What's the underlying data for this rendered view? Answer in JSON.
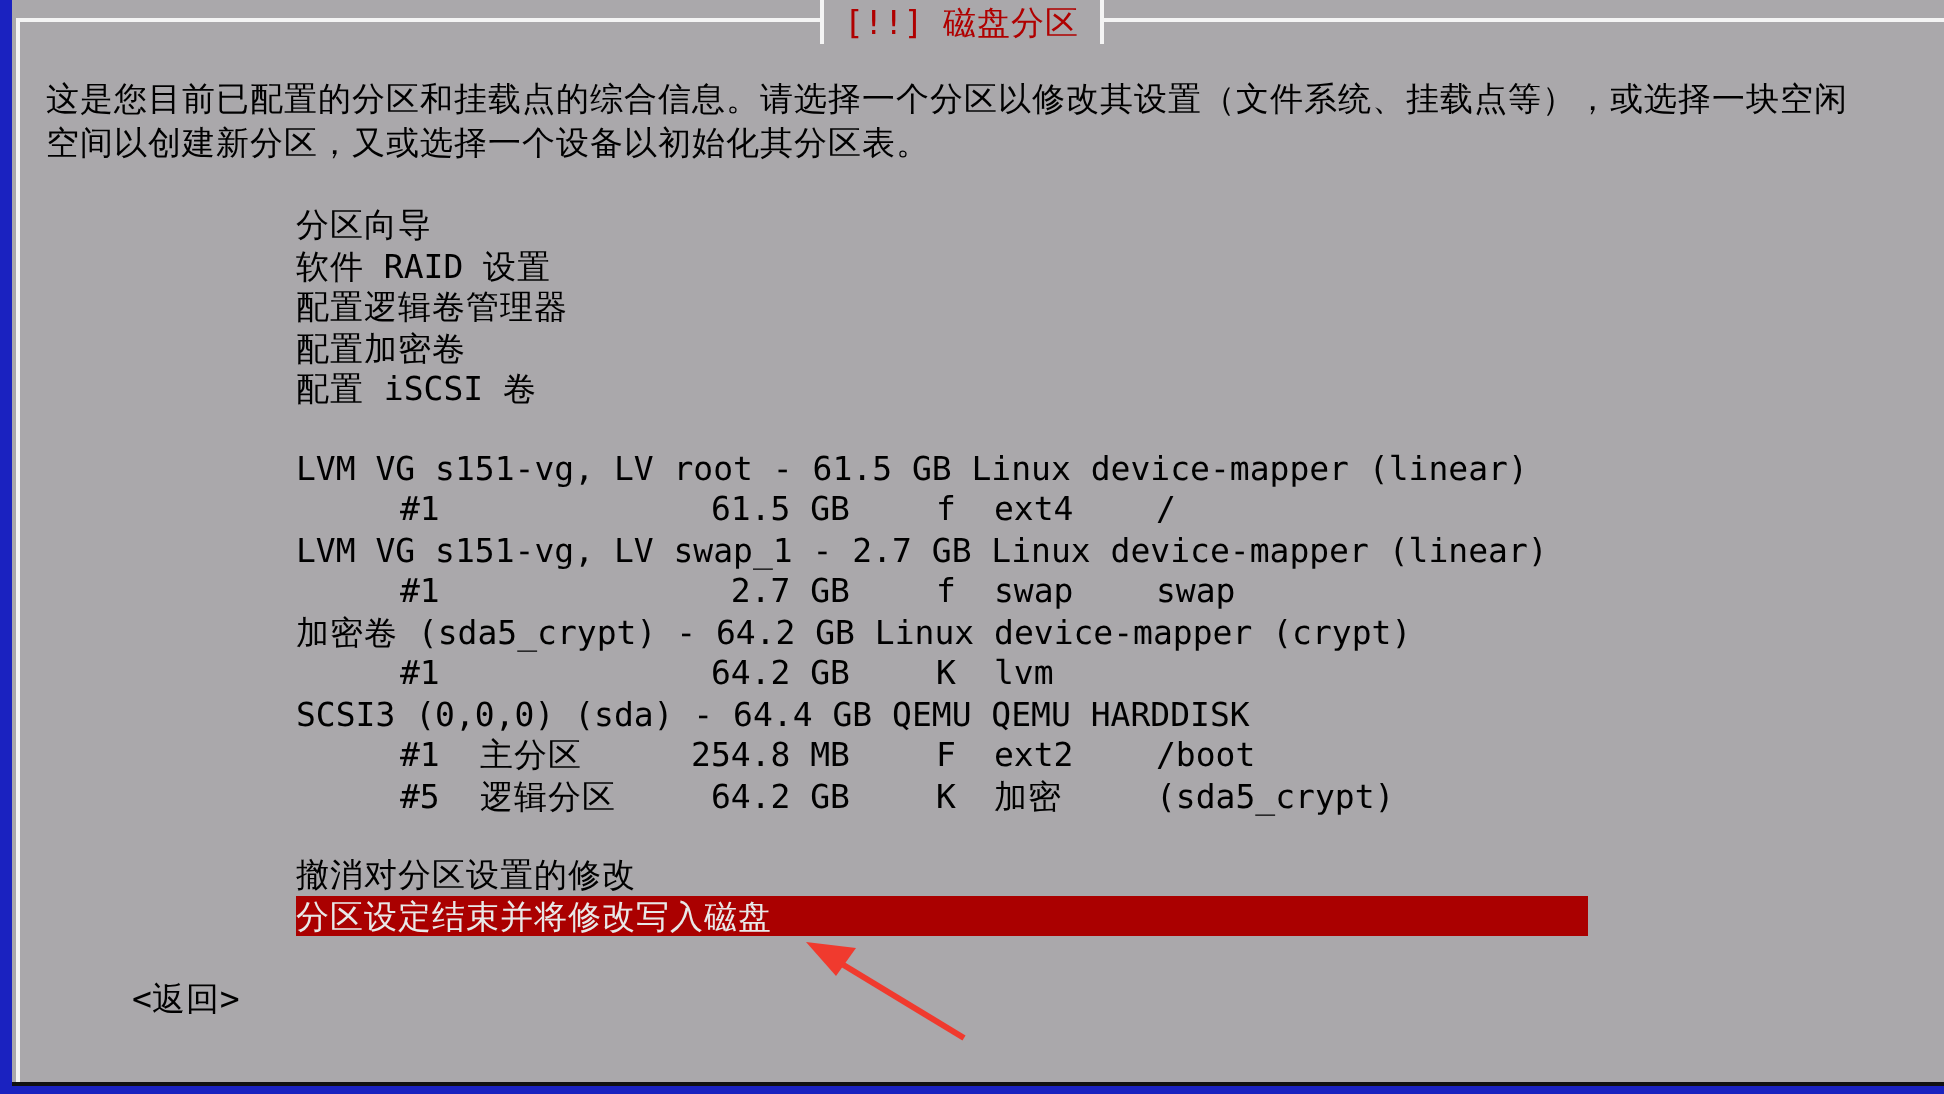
{
  "dialog": {
    "title": "[!!] 磁盘分区",
    "intro": "这是您目前已配置的分区和挂载点的综合信息。请选择一个分区以修改其设置（文件系统、挂载点等），或选择一块空闲空间以创建新分区，又或选择一个设备以初始化其分区表。",
    "actions": [
      {
        "label": "分区向导",
        "selected": false
      },
      {
        "label": "软件 RAID 设置",
        "selected": false
      },
      {
        "label": "配置逻辑卷管理器",
        "selected": false
      },
      {
        "label": "配置加密卷",
        "selected": false
      },
      {
        "label": "配置 iSCSI 卷",
        "selected": false
      }
    ],
    "devices": [
      {
        "label": "LVM VG s151-vg, LV root - 61.5 GB Linux device-mapper (linear)",
        "selected": false,
        "partitions": [
          {
            "number": "#1",
            "size": "61.5 GB",
            "flag": "f",
            "filesystem": "ext4",
            "mount": "/",
            "selected": false
          }
        ]
      },
      {
        "label": "LVM VG s151-vg, LV swap_1 - 2.7 GB Linux device-mapper (linear)",
        "selected": false,
        "partitions": [
          {
            "number": "#1",
            "size": "2.7 GB",
            "flag": "f",
            "filesystem": "swap",
            "mount": "swap",
            "selected": false
          }
        ]
      },
      {
        "label": "加密卷 (sda5_crypt) - 64.2 GB Linux device-mapper (crypt)",
        "selected": false,
        "partitions": [
          {
            "number": "#1",
            "size": "64.2 GB",
            "flag": "K",
            "filesystem": "lvm",
            "selected": false
          }
        ]
      },
      {
        "label": "SCSI3 (0,0,0) (sda) - 64.4 GB QEMU QEMU HARDDISK",
        "selected": false,
        "partitions": [
          {
            "number": "#1",
            "type": "主分区",
            "size": "254.8 MB",
            "flag": "F",
            "filesystem": "ext2",
            "mount": "/boot",
            "selected": false
          },
          {
            "number": "#5",
            "type": "逻辑分区",
            "size": "64.2 GB",
            "flag": "K",
            "filesystem": "加密",
            "mount": "(sda5_crypt)",
            "selected": false
          }
        ]
      }
    ],
    "finish_items": [
      {
        "label": "撤消对分区设置的修改",
        "selected": false
      },
      {
        "label": "分区设定结束并将修改写入磁盘",
        "selected": true
      }
    ],
    "back_button": "<返回>"
  }
}
